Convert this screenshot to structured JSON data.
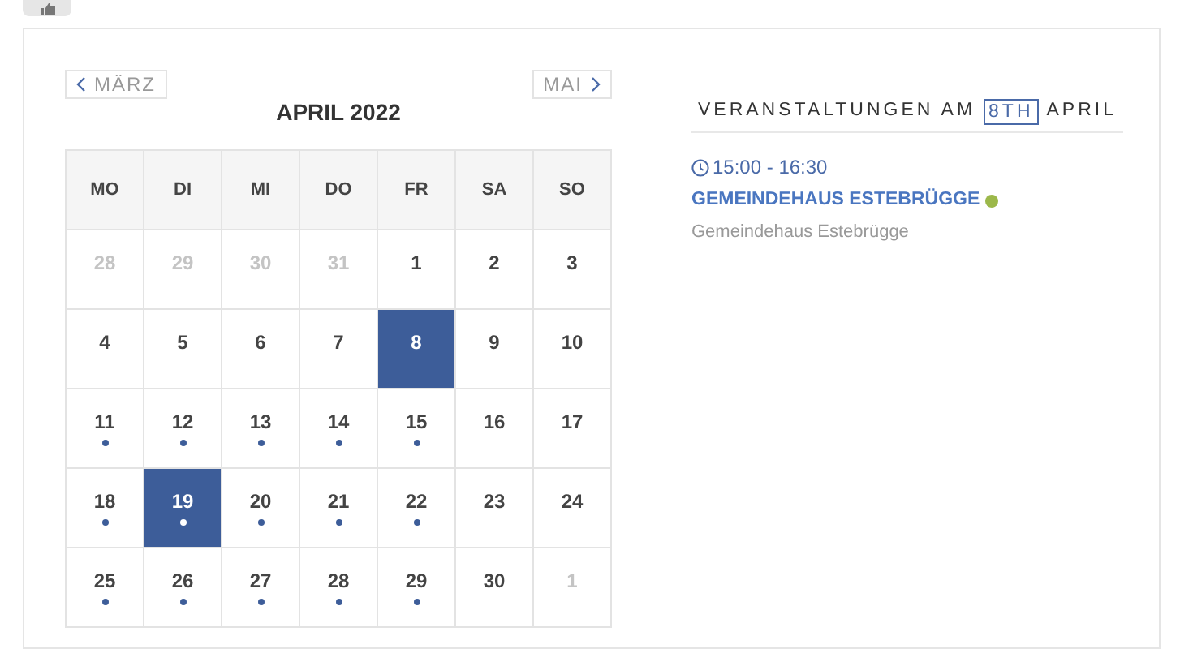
{
  "prev_month": "MÄRZ",
  "next_month": "MAI",
  "month_title": "APRIL 2022",
  "weekdays": [
    "MO",
    "DI",
    "MI",
    "DO",
    "FR",
    "SA",
    "SO"
  ],
  "days": [
    {
      "label": "28",
      "other_month": true,
      "has_events": false,
      "selected": false
    },
    {
      "label": "29",
      "other_month": true,
      "has_events": false,
      "selected": false
    },
    {
      "label": "30",
      "other_month": true,
      "has_events": false,
      "selected": false
    },
    {
      "label": "31",
      "other_month": true,
      "has_events": false,
      "selected": false
    },
    {
      "label": "1",
      "other_month": false,
      "has_events": false,
      "selected": false
    },
    {
      "label": "2",
      "other_month": false,
      "has_events": false,
      "selected": false
    },
    {
      "label": "3",
      "other_month": false,
      "has_events": false,
      "selected": false
    },
    {
      "label": "4",
      "other_month": false,
      "has_events": false,
      "selected": false
    },
    {
      "label": "5",
      "other_month": false,
      "has_events": false,
      "selected": false
    },
    {
      "label": "6",
      "other_month": false,
      "has_events": false,
      "selected": false
    },
    {
      "label": "7",
      "other_month": false,
      "has_events": false,
      "selected": false
    },
    {
      "label": "8",
      "other_month": false,
      "has_events": false,
      "selected": true
    },
    {
      "label": "9",
      "other_month": false,
      "has_events": false,
      "selected": false
    },
    {
      "label": "10",
      "other_month": false,
      "has_events": false,
      "selected": false
    },
    {
      "label": "11",
      "other_month": false,
      "has_events": true,
      "selected": false
    },
    {
      "label": "12",
      "other_month": false,
      "has_events": true,
      "selected": false
    },
    {
      "label": "13",
      "other_month": false,
      "has_events": true,
      "selected": false
    },
    {
      "label": "14",
      "other_month": false,
      "has_events": true,
      "selected": false
    },
    {
      "label": "15",
      "other_month": false,
      "has_events": true,
      "selected": false
    },
    {
      "label": "16",
      "other_month": false,
      "has_events": false,
      "selected": false
    },
    {
      "label": "17",
      "other_month": false,
      "has_events": false,
      "selected": false
    },
    {
      "label": "18",
      "other_month": false,
      "has_events": true,
      "selected": false
    },
    {
      "label": "19",
      "other_month": false,
      "has_events": true,
      "selected": true
    },
    {
      "label": "20",
      "other_month": false,
      "has_events": true,
      "selected": false
    },
    {
      "label": "21",
      "other_month": false,
      "has_events": true,
      "selected": false
    },
    {
      "label": "22",
      "other_month": false,
      "has_events": true,
      "selected": false
    },
    {
      "label": "23",
      "other_month": false,
      "has_events": false,
      "selected": false
    },
    {
      "label": "24",
      "other_month": false,
      "has_events": false,
      "selected": false
    },
    {
      "label": "25",
      "other_month": false,
      "has_events": true,
      "selected": false
    },
    {
      "label": "26",
      "other_month": false,
      "has_events": true,
      "selected": false
    },
    {
      "label": "27",
      "other_month": false,
      "has_events": true,
      "selected": false
    },
    {
      "label": "28",
      "other_month": false,
      "has_events": true,
      "selected": false
    },
    {
      "label": "29",
      "other_month": false,
      "has_events": true,
      "selected": false
    },
    {
      "label": "30",
      "other_month": false,
      "has_events": false,
      "selected": false
    },
    {
      "label": "1",
      "other_month": true,
      "has_events": false,
      "selected": false
    }
  ],
  "events_heading": {
    "prefix": "VERANSTALTUNGEN AM",
    "day": "8TH",
    "month": "APRIL"
  },
  "events": [
    {
      "time": "15:00 - 16:30",
      "title": "GEMEINDEHAUS ESTEBRÜGGE",
      "color": "#9cb84a",
      "location": "Gemeindehaus Estebrügge"
    }
  ]
}
